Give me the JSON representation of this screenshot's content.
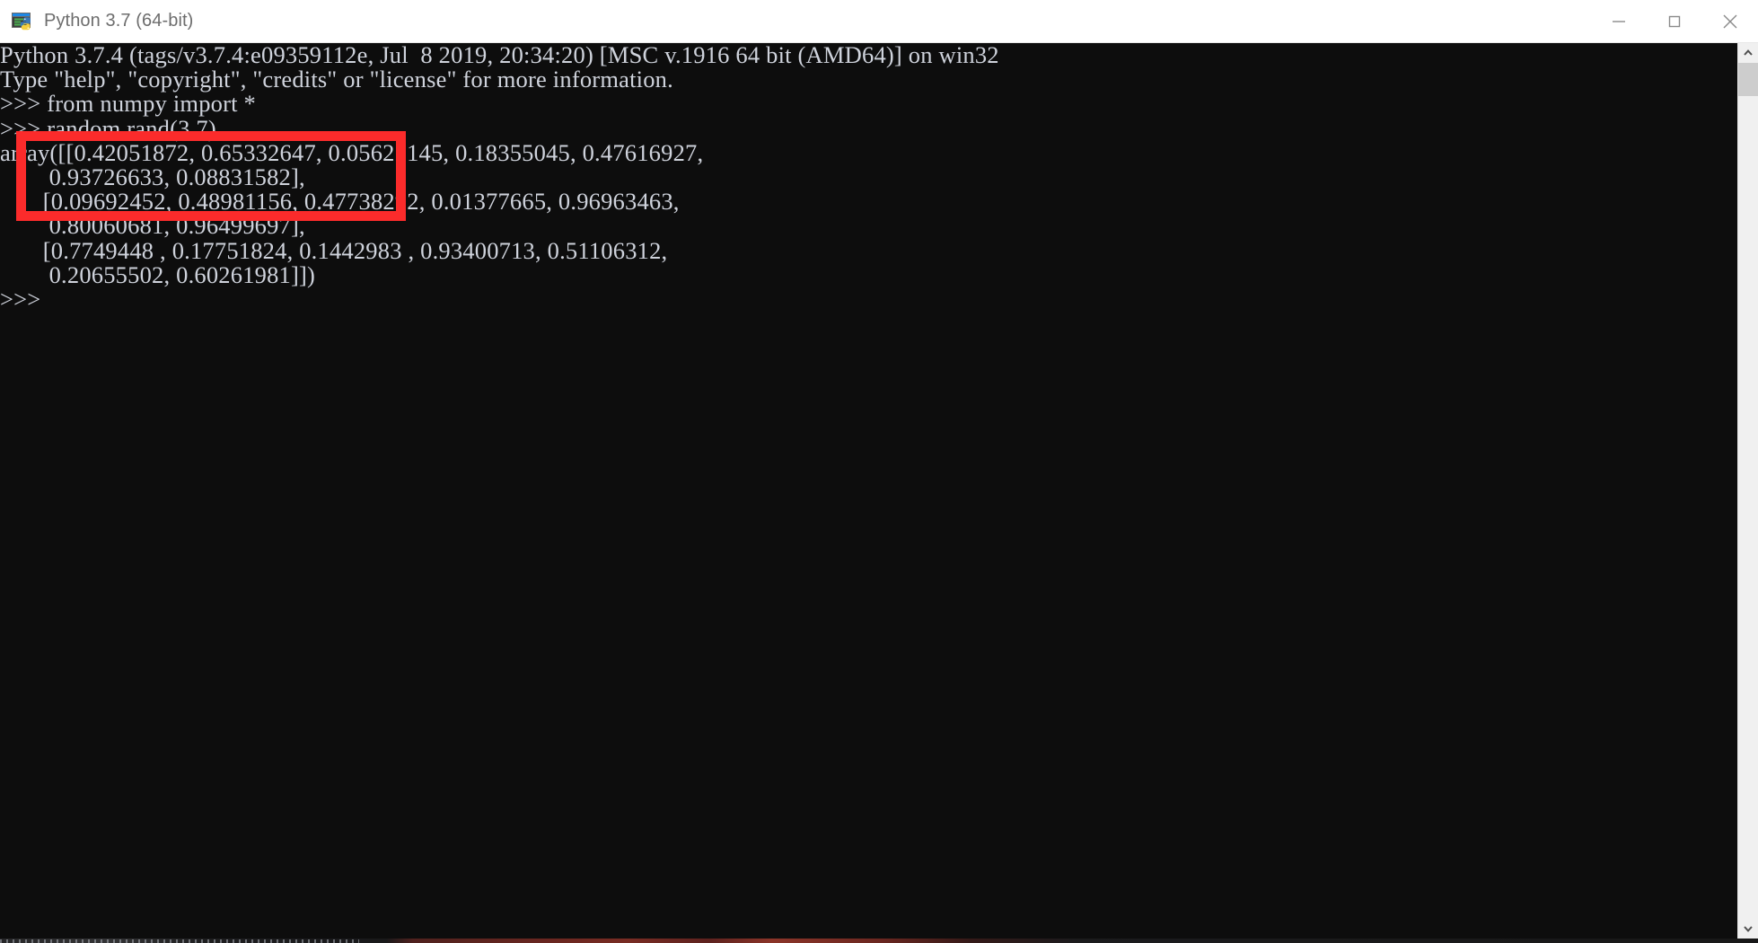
{
  "window": {
    "title": "Python 3.7 (64-bit)",
    "icon": "python-console-icon",
    "controls": {
      "minimize_label": "Minimize",
      "maximize_label": "Maximize",
      "close_label": "Close"
    }
  },
  "console": {
    "background_color": "#0d0d0d",
    "text_color": "#cfd3dc",
    "lines": [
      "Python 3.7.4 (tags/v3.7.4:e09359112e, Jul  8 2019, 20:34:20) [MSC v.1916 64 bit (AMD64)] on win32",
      "Type \"help\", \"copyright\", \"credits\" or \"license\" for more information.",
      ">>> from numpy import *",
      ">>> random.rand(3,7)",
      "array([[0.42051872, 0.65332647, 0.05625145, 0.18355045, 0.47616927,",
      "        0.93726633, 0.08831582],",
      "       [0.09692452, 0.48981156, 0.47738292, 0.01377665, 0.96963463,",
      "        0.80060681, 0.96499697],",
      "       [0.7749448 , 0.17751824, 0.1442983 , 0.93400713, 0.51106312,",
      "        0.20655502, 0.60261981]])",
      ">>>"
    ],
    "commands": [
      ">>> from numpy import *",
      ">>> random.rand(3,7)"
    ],
    "prompt": ">>>"
  },
  "annotation": {
    "color": "#fb2b2b",
    "shape": "rectangle",
    "highlights": "from numpy import * / random.rand(3,7)"
  },
  "scrollbar": {
    "up_arrow": "chevron-up-icon",
    "down_arrow": "chevron-down-icon",
    "thumb_label": "scroll-thumb"
  }
}
